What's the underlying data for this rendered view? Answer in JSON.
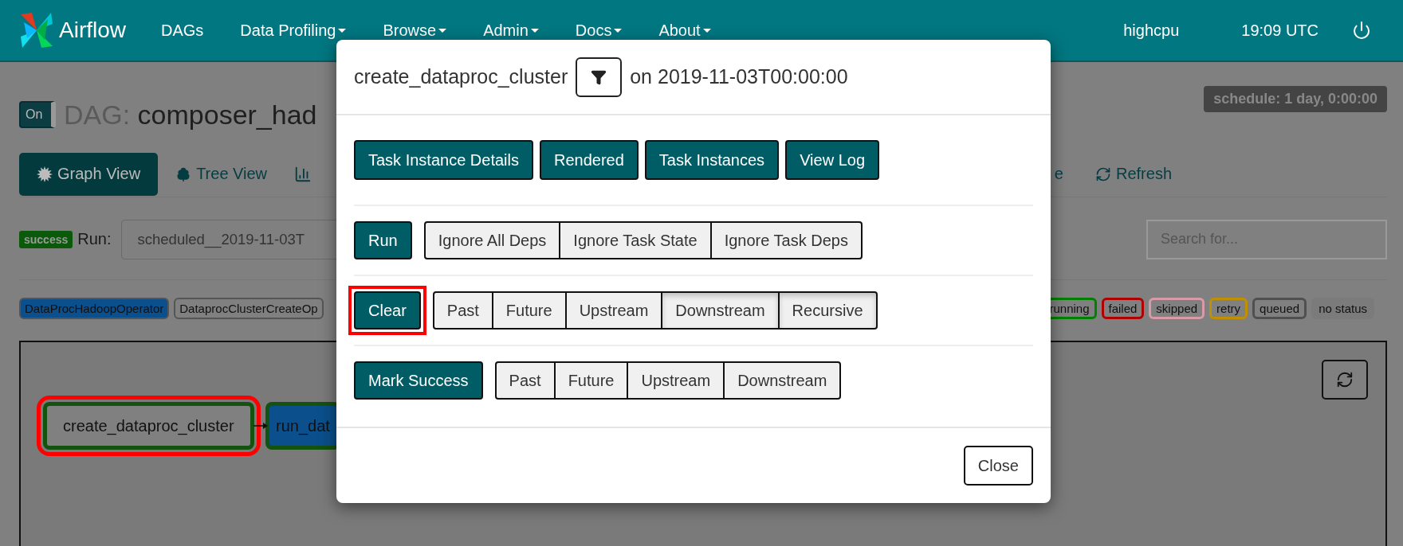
{
  "navbar": {
    "brand": "Airflow",
    "items": [
      {
        "label": "DAGs",
        "dropdown": false
      },
      {
        "label": "Data Profiling",
        "dropdown": true
      },
      {
        "label": "Browse",
        "dropdown": true
      },
      {
        "label": "Admin",
        "dropdown": true
      },
      {
        "label": "Docs",
        "dropdown": true
      },
      {
        "label": "About",
        "dropdown": true
      }
    ],
    "user": "highcpu",
    "clock": "19:09 UTC"
  },
  "dag": {
    "toggle": {
      "label": "On",
      "on": true
    },
    "prefix": "DAG:",
    "name": "composer_had",
    "schedule": "schedule: 1 day, 0:00:00"
  },
  "views": [
    {
      "kind": "burst",
      "label": "Graph View",
      "selected": true
    },
    {
      "kind": "tree",
      "label": "Tree View",
      "selected": false
    },
    {
      "kind": "bars",
      "selected": false
    }
  ],
  "links": [
    {
      "kind": "text",
      "label": "e"
    },
    {
      "kind": "refresh",
      "label": "Refresh"
    }
  ],
  "run": {
    "state": "success",
    "label": "Run:",
    "value": "scheduled__2019-11-03T",
    "search_placeholder": "Search for..."
  },
  "legend": {
    "operators": [
      {
        "label": "DataProcHadoopOperator",
        "color": "#0b4f8c"
      },
      {
        "label": "DataprocClusterCreateOp",
        "color": "#808080"
      }
    ],
    "states": [
      {
        "label": "running",
        "kind": "border",
        "color": "#008000"
      },
      {
        "label": "failed",
        "kind": "border",
        "color": "#b00000"
      },
      {
        "label": "skipped",
        "kind": "border",
        "color": "#d99aa8"
      },
      {
        "label": "retry",
        "kind": "border",
        "color": "#c09000"
      },
      {
        "label": "queued",
        "kind": "border",
        "color": "#505050"
      },
      {
        "label": "no status",
        "kind": "plain",
        "color": "#7b7b7b"
      }
    ]
  },
  "graph": {
    "nodes": [
      {
        "label": "create_dataproc_cluster",
        "color": "#808080",
        "highlighted": true
      },
      {
        "label": "run_dat",
        "color": "#0b4f8c",
        "highlighted": false
      }
    ]
  },
  "modal": {
    "task": "create_dataproc_cluster",
    "date_text": "on 2019-11-03T00:00:00",
    "links": [
      "Task Instance Details",
      "Rendered",
      "Task Instances",
      "View Log"
    ],
    "actions": [
      {
        "label": "Run",
        "highlighted": false,
        "options": [
          {
            "label": "Ignore All Deps",
            "active": false
          },
          {
            "label": "Ignore Task State",
            "active": false
          },
          {
            "label": "Ignore Task Deps",
            "active": false
          }
        ]
      },
      {
        "label": "Clear",
        "highlighted": true,
        "options": [
          {
            "label": "Past",
            "active": false
          },
          {
            "label": "Future",
            "active": false
          },
          {
            "label": "Upstream",
            "active": false
          },
          {
            "label": "Downstream",
            "active": true
          },
          {
            "label": "Recursive",
            "active": true
          }
        ]
      },
      {
        "label": "Mark Success",
        "highlighted": false,
        "options": [
          {
            "label": "Past",
            "active": false
          },
          {
            "label": "Future",
            "active": false
          },
          {
            "label": "Upstream",
            "active": false
          },
          {
            "label": "Downstream",
            "active": false
          }
        ]
      }
    ],
    "close": "Close"
  }
}
